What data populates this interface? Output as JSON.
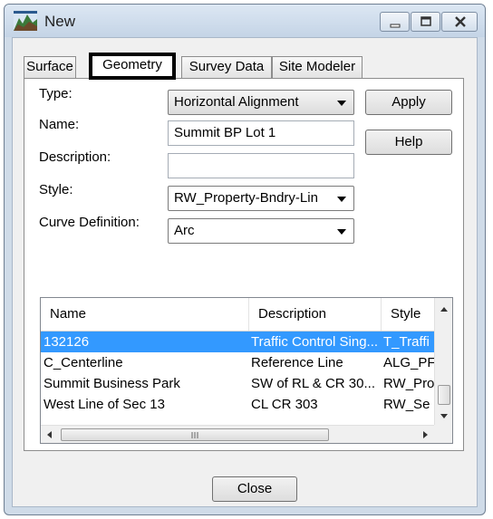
{
  "window": {
    "title": "New",
    "icon": "terrain-app-icon",
    "caption_buttons": [
      "minimize",
      "maximize",
      "close"
    ]
  },
  "tabs": [
    {
      "label": "Surface",
      "active": false
    },
    {
      "label": "Geometry",
      "active": true
    },
    {
      "label": "Survey Data",
      "active": false
    },
    {
      "label": "Site Modeler",
      "active": false
    }
  ],
  "form": {
    "type_label": "Type:",
    "type_value": "Horizontal Alignment",
    "name_label": "Name:",
    "name_value": "Summit BP Lot 1",
    "description_label": "Description:",
    "description_value": "",
    "style_label": "Style:",
    "style_value": "RW_Property-Bndry-Lin",
    "curve_label": "Curve Definition:",
    "curve_value": "Arc"
  },
  "buttons": {
    "apply": "Apply",
    "help": "Help",
    "close": "Close"
  },
  "list": {
    "columns": [
      "Name",
      "Description",
      "Style"
    ],
    "rows": [
      {
        "name": "132126",
        "description": "Traffic Control Sing...",
        "style": "T_Traffi",
        "selected": true
      },
      {
        "name": "C_Centerline",
        "description": "Reference Line",
        "style": "ALG_PF",
        "selected": false
      },
      {
        "name": "Summit Business Park",
        "description": "SW of RL & CR 30...",
        "style": "RW_Pro",
        "selected": false
      },
      {
        "name": "West Line of Sec 13",
        "description": "CL CR 303",
        "style": "RW_Se",
        "selected": false
      }
    ]
  }
}
